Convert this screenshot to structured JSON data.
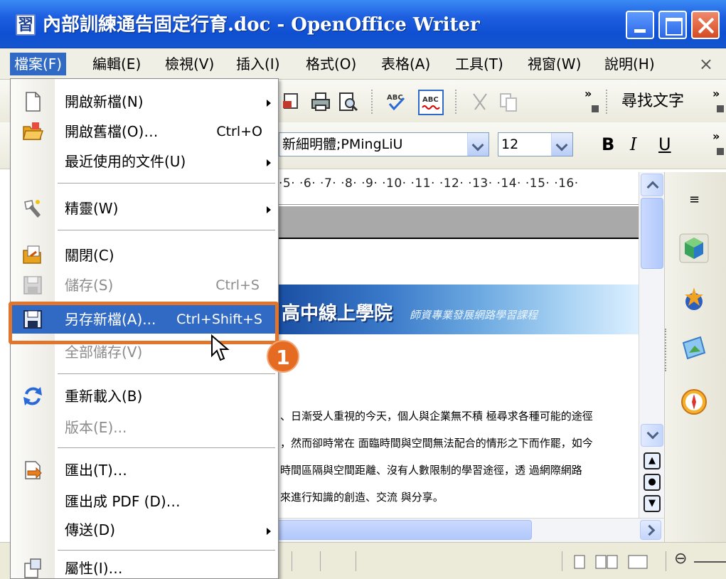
{
  "window": {
    "title": "內部訓練通告固定行育.doc - OpenOffice Writer",
    "app_icon_glyph": "習"
  },
  "menubar": {
    "items": [
      {
        "label": "檔案(F)",
        "active": true
      },
      {
        "label": "編輯(E)"
      },
      {
        "label": "檢視(V)"
      },
      {
        "label": "插入(I)"
      },
      {
        "label": "格式(O)"
      },
      {
        "label": "表格(A)"
      },
      {
        "label": "工具(T)"
      },
      {
        "label": "視窗(W)"
      },
      {
        "label": "說明(H)"
      }
    ],
    "close_glyph": "×"
  },
  "toolbar": {
    "find_text_label": "尋找文字",
    "font_name": "新細明體;PMingLiU",
    "font_size": "12",
    "bold_label": "B",
    "italic_label": "I",
    "underline_label": "U"
  },
  "ruler": {
    "text": "·5· ·6· ·7· ·8· ·9· ·10· ·11· ·12· ·13· ·14· ·15· ·16·"
  },
  "document": {
    "banner_title": "高中線上學院",
    "banner_subtitle": "師資專業發展網路學習課程",
    "lines": [
      "、日漸受人重視的今天，個人與企業無不積 極尋求各種可能的途徑",
      "，然而卻時常在 面臨時間與空間無法配合的情形之下而作罷，如今",
      "時間區隔與空間距離、沒有人數限制的學習途徑，透 過網際網路",
      "來進行知識的創造、交流 與分享。"
    ]
  },
  "file_menu": {
    "items": [
      {
        "label": "開啟新檔(N)",
        "shortcut": "",
        "submenu": true,
        "icon": "new-document-icon"
      },
      {
        "label": "開啟舊檔(O)…",
        "shortcut": "Ctrl+O",
        "submenu": false,
        "icon": "open-folder-icon"
      },
      {
        "label": "最近使用的文件(U)",
        "shortcut": "",
        "submenu": true,
        "icon": ""
      },
      {
        "label": "精靈(W)",
        "shortcut": "",
        "submenu": true,
        "icon": "wizard-icon"
      },
      {
        "label": "關閉(C)",
        "shortcut": "",
        "submenu": false,
        "icon": "close-document-icon"
      },
      {
        "label": "儲存(S)",
        "shortcut": "Ctrl+S",
        "submenu": false,
        "disabled": true,
        "icon": "save-icon"
      },
      {
        "label": "另存新檔(A)...",
        "shortcut": "Ctrl+Shift+S",
        "submenu": false,
        "highlight": true,
        "icon": "save-as-icon"
      },
      {
        "label": "全部儲存(V)",
        "shortcut": "",
        "submenu": false,
        "disabled": true,
        "icon": ""
      },
      {
        "label": "重新載入(B)",
        "shortcut": "",
        "submenu": false,
        "icon": "reload-icon"
      },
      {
        "label": "版本(E)...",
        "shortcut": "",
        "submenu": false,
        "disabled": true,
        "icon": ""
      },
      {
        "label": "匯出(T)…",
        "shortcut": "",
        "submenu": false,
        "icon": "export-icon"
      },
      {
        "label": "匯出成 PDF (D)…",
        "shortcut": "",
        "submenu": false,
        "icon": ""
      },
      {
        "label": "傳送(D)",
        "shortcut": "",
        "submenu": true,
        "icon": ""
      },
      {
        "label": "屬性(I)…",
        "shortcut": "",
        "submenu": false,
        "icon": "properties-icon"
      }
    ]
  },
  "annotation": {
    "step_number": "1",
    "color": "#e0752b"
  },
  "colors": {
    "titlebar": "#0f4fd2",
    "menu_highlight": "#316ac5",
    "menu_bg": "#f0efe6"
  }
}
